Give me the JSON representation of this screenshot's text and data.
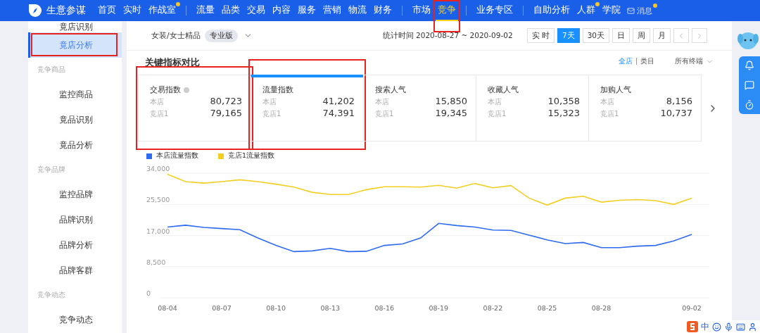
{
  "top_nav": {
    "brand": "生意参谋",
    "groups": [
      [
        {
          "label": "首页",
          "selected": false,
          "dot": false,
          "highlighted": false
        },
        {
          "label": "实时",
          "selected": false,
          "dot": false,
          "highlighted": false
        },
        {
          "label": "作战室",
          "selected": false,
          "dot": true,
          "highlighted": false
        }
      ],
      [
        {
          "label": "流量",
          "selected": false,
          "dot": false,
          "highlighted": false
        },
        {
          "label": "品类",
          "selected": false,
          "dot": false,
          "highlighted": false
        },
        {
          "label": "交易",
          "selected": false,
          "dot": false,
          "highlighted": false
        },
        {
          "label": "内容",
          "selected": false,
          "dot": false,
          "highlighted": false
        },
        {
          "label": "服务",
          "selected": false,
          "dot": false,
          "highlighted": false
        },
        {
          "label": "营销",
          "selected": false,
          "dot": false,
          "highlighted": false
        },
        {
          "label": "物流",
          "selected": false,
          "dot": false,
          "highlighted": false
        },
        {
          "label": "财务",
          "selected": false,
          "dot": false,
          "highlighted": false
        }
      ],
      [
        {
          "label": "市场",
          "selected": false,
          "dot": false,
          "highlighted": false
        },
        {
          "label": "竞争",
          "selected": true,
          "dot": false,
          "highlighted": true
        }
      ],
      [
        {
          "label": "业务专区",
          "selected": false,
          "dot": false,
          "highlighted": false
        }
      ],
      [
        {
          "label": "自助分析",
          "selected": false,
          "dot": false,
          "highlighted": false
        },
        {
          "label": "人群",
          "selected": false,
          "dot": true,
          "highlighted": false
        },
        {
          "label": "学院",
          "selected": false,
          "dot": false,
          "highlighted": false
        }
      ]
    ],
    "messages": {
      "label": "消息",
      "dot": true
    }
  },
  "sidebar": {
    "items": [
      {
        "kind": "item",
        "label": "竟店识别",
        "selected": false,
        "highlighted": false
      },
      {
        "kind": "item",
        "label": "竟店分析",
        "selected": true,
        "highlighted": true
      },
      {
        "kind": "heading",
        "label": "竞争商品"
      },
      {
        "kind": "item",
        "label": "监控商品",
        "selected": false,
        "highlighted": false
      },
      {
        "kind": "item",
        "label": "竟品识别",
        "selected": false,
        "highlighted": false
      },
      {
        "kind": "item",
        "label": "竟品分析",
        "selected": false,
        "highlighted": false
      },
      {
        "kind": "heading",
        "label": "竞争品牌"
      },
      {
        "kind": "item",
        "label": "监控品牌",
        "selected": false,
        "highlighted": false
      },
      {
        "kind": "item",
        "label": "品牌识别",
        "selected": false,
        "highlighted": false
      },
      {
        "kind": "item",
        "label": "品牌分析",
        "selected": false,
        "highlighted": false
      },
      {
        "kind": "item",
        "label": "品牌客群",
        "selected": false,
        "highlighted": false
      },
      {
        "kind": "heading",
        "label": "竞争动态"
      },
      {
        "kind": "item",
        "label": "竞争动态",
        "selected": false,
        "highlighted": false
      }
    ]
  },
  "toolbar": {
    "category": "女装/女士精品",
    "edition": "专业版",
    "stat_time": "统计时间 2020-08-27 ~ 2020-09-02",
    "periods": [
      {
        "label": "实 时",
        "selected": false
      },
      {
        "label": "7天",
        "selected": true
      },
      {
        "label": "30天",
        "selected": false
      },
      {
        "label": "日",
        "selected": false
      },
      {
        "label": "周",
        "selected": false
      },
      {
        "label": "月",
        "selected": false
      }
    ]
  },
  "section": {
    "title": "关键指标对比",
    "scope": [
      {
        "label": "全店",
        "selected": true
      },
      {
        "label": "类目",
        "selected": false
      }
    ],
    "terminal": "所有终端"
  },
  "metrics": [
    {
      "name": "交易指数",
      "info": true,
      "selected": false,
      "highlighted": true,
      "rows": [
        {
          "label": "本店",
          "value": "80,723"
        },
        {
          "label": "竞店1",
          "value": "79,165"
        }
      ]
    },
    {
      "name": "流量指数",
      "info": false,
      "selected": true,
      "highlighted": true,
      "rows": [
        {
          "label": "本店",
          "value": "41,202"
        },
        {
          "label": "竞店1",
          "value": "74,391"
        }
      ]
    },
    {
      "name": "搜索人气",
      "info": false,
      "selected": false,
      "highlighted": false,
      "rows": [
        {
          "label": "本店",
          "value": "15,850"
        },
        {
          "label": "竞店1",
          "value": "19,345"
        }
      ]
    },
    {
      "name": "收藏人气",
      "info": false,
      "selected": false,
      "highlighted": false,
      "rows": [
        {
          "label": "本店",
          "value": "10,358"
        },
        {
          "label": "竞店1",
          "value": "15,323"
        }
      ]
    },
    {
      "name": "加购人气",
      "info": false,
      "selected": false,
      "highlighted": false,
      "rows": [
        {
          "label": "本店",
          "value": "8,156"
        },
        {
          "label": "竞店1",
          "value": "10,737"
        }
      ]
    }
  ],
  "chart_data": {
    "type": "line",
    "grid": true,
    "categories": [
      "08-04",
      null,
      null,
      "08-07",
      null,
      null,
      "08-10",
      null,
      null,
      "08-13",
      null,
      null,
      "08-16",
      null,
      null,
      "08-19",
      null,
      null,
      "08-22",
      null,
      null,
      "08-25",
      null,
      null,
      "08-28",
      null,
      null,
      null,
      null,
      "09-02"
    ],
    "yticks": [
      {
        "value": 0,
        "label": "0"
      },
      {
        "value": 8500,
        "label": "8,500"
      },
      {
        "value": 17000,
        "label": "17,000"
      },
      {
        "value": 25500,
        "label": "25,500"
      },
      {
        "value": 34000,
        "label": "34,000"
      }
    ],
    "ylim": [
      0,
      34000
    ],
    "series": [
      {
        "name": "本店流量指数",
        "color": "#2f6bf0",
        "values": [
          19300,
          19800,
          19200,
          18900,
          18600,
          16300,
          14300,
          12600,
          12800,
          13500,
          12600,
          12700,
          14300,
          14700,
          16300,
          20300,
          19700,
          19300,
          18500,
          18400,
          17100,
          15800,
          14800,
          15100,
          13700,
          13700,
          14100,
          14300,
          15500,
          17300
        ]
      },
      {
        "name": "竞店1流量指数",
        "color": "#f2cf22",
        "values": [
          33700,
          31700,
          31300,
          31700,
          32200,
          31700,
          31000,
          30200,
          28800,
          28200,
          28200,
          29500,
          30300,
          30300,
          30200,
          30700,
          29900,
          31200,
          30000,
          30600,
          27200,
          25300,
          27200,
          27700,
          26100,
          26600,
          26800,
          26500,
          25500,
          27200
        ]
      }
    ]
  },
  "ime_bar": {
    "label": "中"
  }
}
